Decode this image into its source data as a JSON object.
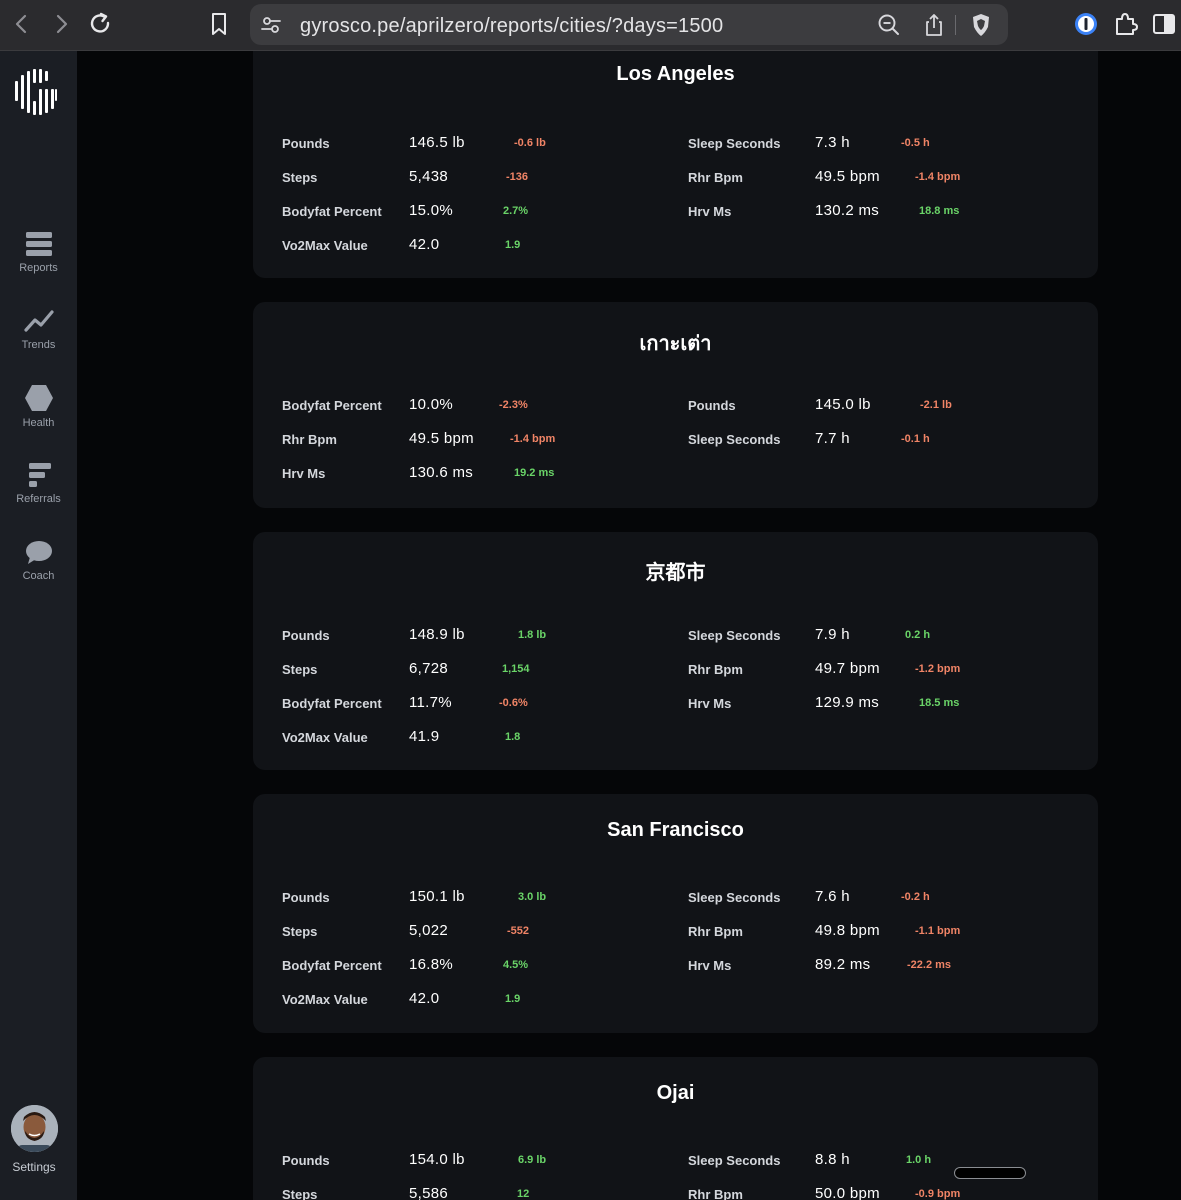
{
  "browser": {
    "url": "gyrosco.pe/aprilzero/reports/cities/?days=1500"
  },
  "sidebar": {
    "items": [
      {
        "label": "Reports",
        "icon": "reports-icon"
      },
      {
        "label": "Trends",
        "icon": "trends-icon"
      },
      {
        "label": "Health",
        "icon": "health-icon"
      },
      {
        "label": "Referrals",
        "icon": "referrals-icon"
      },
      {
        "label": "Coach",
        "icon": "coach-icon"
      }
    ],
    "settings_label": "Settings"
  },
  "colors": {
    "negative": "#f08466",
    "positive": "#6ad468",
    "card_bg": "#111317",
    "sidebar_bg": "#1b1e24"
  },
  "cards": [
    {
      "title": "Los Angeles",
      "left": [
        {
          "label": "Pounds",
          "value": "146.5 lb",
          "delta": "-0.6 lb",
          "dir": "neg"
        },
        {
          "label": "Steps",
          "value": "5,438",
          "delta": "-136",
          "dir": "neg"
        },
        {
          "label": "Bodyfat Percent",
          "value": "15.0%",
          "delta": "2.7%",
          "dir": "pos"
        },
        {
          "label": "Vo2Max Value",
          "value": "42.0",
          "delta": "1.9",
          "dir": "pos"
        }
      ],
      "right": [
        {
          "label": "Sleep Seconds",
          "value": "7.3 h",
          "delta": "-0.5 h",
          "dir": "neg"
        },
        {
          "label": "Rhr Bpm",
          "value": "49.5 bpm",
          "delta": "-1.4 bpm",
          "dir": "neg"
        },
        {
          "label": "Hrv Ms",
          "value": "130.2 ms",
          "delta": "18.8 ms",
          "dir": "pos"
        }
      ]
    },
    {
      "title": "เกาะเต่า",
      "left": [
        {
          "label": "Bodyfat Percent",
          "value": "10.0%",
          "delta": "-2.3%",
          "dir": "neg"
        },
        {
          "label": "Rhr Bpm",
          "value": "49.5 bpm",
          "delta": "-1.4 bpm",
          "dir": "neg"
        },
        {
          "label": "Hrv Ms",
          "value": "130.6 ms",
          "delta": "19.2 ms",
          "dir": "pos"
        }
      ],
      "right": [
        {
          "label": "Pounds",
          "value": "145.0 lb",
          "delta": "-2.1 lb",
          "dir": "neg"
        },
        {
          "label": "Sleep Seconds",
          "value": "7.7 h",
          "delta": "-0.1 h",
          "dir": "neg"
        }
      ]
    },
    {
      "title": "京都市",
      "left": [
        {
          "label": "Pounds",
          "value": "148.9 lb",
          "delta": "1.8 lb",
          "dir": "pos"
        },
        {
          "label": "Steps",
          "value": "6,728",
          "delta": "1,154",
          "dir": "pos"
        },
        {
          "label": "Bodyfat Percent",
          "value": "11.7%",
          "delta": "-0.6%",
          "dir": "neg"
        },
        {
          "label": "Vo2Max Value",
          "value": "41.9",
          "delta": "1.8",
          "dir": "pos"
        }
      ],
      "right": [
        {
          "label": "Sleep Seconds",
          "value": "7.9 h",
          "delta": "0.2 h",
          "dir": "pos"
        },
        {
          "label": "Rhr Bpm",
          "value": "49.7 bpm",
          "delta": "-1.2 bpm",
          "dir": "neg"
        },
        {
          "label": "Hrv Ms",
          "value": "129.9 ms",
          "delta": "18.5 ms",
          "dir": "pos"
        }
      ]
    },
    {
      "title": "San Francisco",
      "left": [
        {
          "label": "Pounds",
          "value": "150.1 lb",
          "delta": "3.0 lb",
          "dir": "pos"
        },
        {
          "label": "Steps",
          "value": "5,022",
          "delta": "-552",
          "dir": "neg"
        },
        {
          "label": "Bodyfat Percent",
          "value": "16.8%",
          "delta": "4.5%",
          "dir": "pos"
        },
        {
          "label": "Vo2Max Value",
          "value": "42.0",
          "delta": "1.9",
          "dir": "pos"
        }
      ],
      "right": [
        {
          "label": "Sleep Seconds",
          "value": "7.6 h",
          "delta": "-0.2 h",
          "dir": "neg"
        },
        {
          "label": "Rhr Bpm",
          "value": "49.8 bpm",
          "delta": "-1.1 bpm",
          "dir": "neg"
        },
        {
          "label": "Hrv Ms",
          "value": "89.2 ms",
          "delta": "-22.2 ms",
          "dir": "neg"
        }
      ]
    },
    {
      "title": "Ojai",
      "left": [
        {
          "label": "Pounds",
          "value": "154.0 lb",
          "delta": "6.9 lb",
          "dir": "pos"
        },
        {
          "label": "Steps",
          "value": "5,586",
          "delta": "12",
          "dir": "pos"
        }
      ],
      "right": [
        {
          "label": "Sleep Seconds",
          "value": "8.8 h",
          "delta": "1.0 h",
          "dir": "pos"
        },
        {
          "label": "Rhr Bpm",
          "value": "50.0 bpm",
          "delta": "-0.9 bpm",
          "dir": "neg"
        }
      ]
    }
  ]
}
